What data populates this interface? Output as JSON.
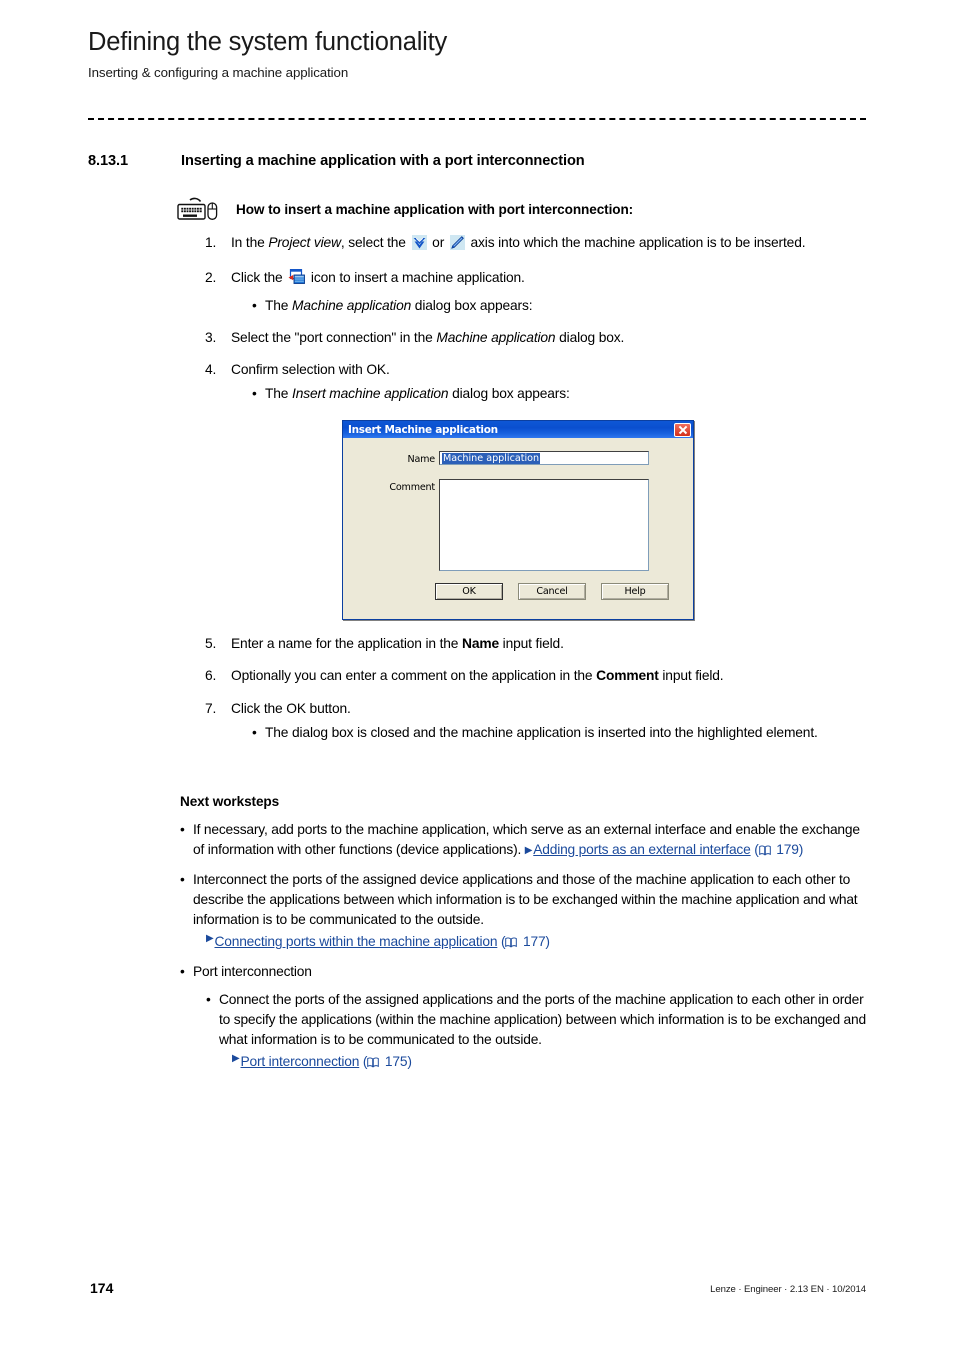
{
  "header": {
    "title": "Defining the system functionality",
    "subtitle": "Inserting & configuring a machine application"
  },
  "section": {
    "number": "8.13.1",
    "title": "Inserting a machine application with a port interconnection"
  },
  "howto": {
    "icon": "keyboard-mouse-icon",
    "label": "How to insert a machine application with port interconnection:"
  },
  "steps": [
    {
      "num": "1.",
      "parts": [
        {
          "t": "text",
          "v": "In the "
        },
        {
          "t": "em",
          "v": "Project view"
        },
        {
          "t": "text",
          "v": ", select the "
        },
        {
          "t": "icon",
          "v": "axis-blue-heart-icon"
        },
        {
          "t": "text",
          "v": " or "
        },
        {
          "t": "icon",
          "v": "axis-blue-bar-icon"
        },
        {
          "t": "text",
          "v": " axis into which the machine application is to be inserted."
        }
      ],
      "subs": []
    },
    {
      "num": "2.",
      "parts": [
        {
          "t": "text",
          "v": "Click the "
        },
        {
          "t": "icon",
          "v": "insert-machine-application-icon"
        },
        {
          "t": "text",
          "v": " icon to insert a machine application."
        }
      ],
      "subs": [
        [
          {
            "t": "text",
            "v": "The "
          },
          {
            "t": "em",
            "v": "Machine application"
          },
          {
            "t": "text",
            "v": " dialog box appears:"
          }
        ]
      ]
    },
    {
      "num": "3.",
      "parts": [
        {
          "t": "text",
          "v": "Select the \"port connection\" in the "
        },
        {
          "t": "em",
          "v": "Machine application"
        },
        {
          "t": "text",
          "v": " dialog box."
        }
      ],
      "subs": []
    },
    {
      "num": "4.",
      "parts": [
        {
          "t": "text",
          "v": "Confirm selection with OK."
        }
      ],
      "subs": [
        [
          {
            "t": "text",
            "v": "The "
          },
          {
            "t": "em",
            "v": "Insert machine application"
          },
          {
            "t": "text",
            "v": " dialog box appears:"
          }
        ]
      ]
    }
  ],
  "dialog": {
    "title": "Insert Machine application",
    "close_icon": "close-icon",
    "name_label": "Name",
    "name_value": "Machine application",
    "comment_label": "Comment",
    "comment_value": "",
    "buttons": {
      "ok": "OK",
      "cancel": "Cancel",
      "help": "Help"
    }
  },
  "steps2": [
    {
      "num": "5.",
      "parts": [
        {
          "t": "text",
          "v": "Enter a name for the application in the "
        },
        {
          "t": "strong",
          "v": "Name"
        },
        {
          "t": "text",
          "v": " input field."
        }
      ],
      "subs": []
    },
    {
      "num": "6.",
      "parts": [
        {
          "t": "text",
          "v": "Optionally you can enter a comment on the application in the "
        },
        {
          "t": "strong",
          "v": "Comment"
        },
        {
          "t": "text",
          "v": " input field."
        }
      ],
      "subs": []
    },
    {
      "num": "7.",
      "parts": [
        {
          "t": "text",
          "v": "Click the OK button."
        }
      ],
      "subs": [
        [
          {
            "t": "text",
            "v": "The dialog box is closed and the machine application is inserted into the highlighted element."
          }
        ]
      ]
    }
  ],
  "next": {
    "title": "Next worksteps",
    "bullets": [
      {
        "parts": [
          {
            "t": "text",
            "v": "If necessary, add ports to the machine application, which serve as an external interface and enable the exchange of information with other functions (device applications). "
          },
          {
            "t": "xref",
            "v": "Adding ports as an external interface"
          },
          {
            "t": "text",
            "v": " "
          },
          {
            "t": "pgref",
            "v": "179"
          }
        ],
        "subs": []
      },
      {
        "parts": [
          {
            "t": "text",
            "v": "Interconnect the ports of the assigned device applications and those of the machine application to each other to describe the applications between which information is to be exchanged within the machine application and what information is to be communicated to the outside."
          }
        ],
        "xref_line": {
          "label": "Connecting ports within the machine application",
          "page": "177"
        },
        "subs": []
      },
      {
        "parts": [
          {
            "t": "text",
            "v": "Port interconnection"
          }
        ],
        "subs": [
          {
            "parts": [
              {
                "t": "text",
                "v": "Connect the ports of the assigned applications and the ports of the machine application to each other in order to specify the applications (within the machine application) between which information is to be exchanged and what information is to be communicated to the outside."
              }
            ],
            "xref_line": {
              "label": "Port interconnection",
              "page": "175"
            }
          }
        ]
      }
    ]
  },
  "footer": {
    "page_number": "174",
    "meta": "Lenze · Engineer · 2.13 EN · 10/2014"
  },
  "colors": {
    "link": "#1b4a9c",
    "dialog_titlebar": "#0a4fcf",
    "dialog_face": "#ece9d8",
    "selection": "#2b5fb8"
  },
  "bullet_char": "•",
  "xref_arrow": "▶"
}
